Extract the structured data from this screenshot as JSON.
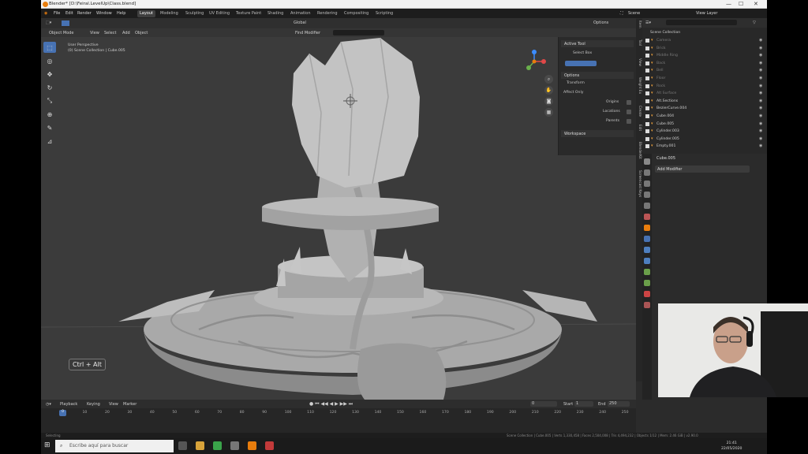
{
  "window": {
    "title": "Blender* [D:\\Feiral.LevelUp\\Class.blend]",
    "controls": [
      "—",
      "☐",
      "✕"
    ]
  },
  "menu": [
    "File",
    "Edit",
    "Render",
    "Window",
    "Help"
  ],
  "workspaces": [
    "Layout",
    "Modeling",
    "Sculpting",
    "UV Editing",
    "Texture Paint",
    "Shading",
    "Animation",
    "Rendering",
    "Compositing",
    "Scripting"
  ],
  "scene": {
    "label": "Scene",
    "view_layer": "View Layer"
  },
  "viewport": {
    "mode": "Object Mode",
    "menu": [
      "View",
      "Select",
      "Add",
      "Object"
    ],
    "orientation": "Global",
    "find_modifier": "Find Modifier",
    "options": "Options",
    "info_line1": "User Perspective",
    "info_line2": "(0) Scene Collection | Cube.005",
    "shortcut_overlay": "Ctrl + Alt"
  },
  "npanel": {
    "active_tool": "Active Tool",
    "tool_name": "Select Box",
    "options": "Options",
    "transform": "Transform",
    "affect_only": "Affect Only",
    "origins": "Origins",
    "locations": "Locations",
    "parents": "Parents",
    "workspace": "Workspace",
    "tabs": [
      "Item",
      "Tool",
      "View",
      "Weight Ex",
      "Create",
      "Edit",
      "BlenderKit",
      "Screencast Keys"
    ]
  },
  "outliner": {
    "title": "Scene Collection",
    "rows": [
      {
        "name": "Camera",
        "dim": true
      },
      {
        "name": "Brick",
        "dim": true
      },
      {
        "name": "Middle Ring",
        "dim": true
      },
      {
        "name": "Back",
        "dim": true
      },
      {
        "name": "Bell",
        "dim": true
      },
      {
        "name": "Floor",
        "dim": true
      },
      {
        "name": "Rock",
        "dim": true
      },
      {
        "name": "Alt Surface",
        "dim": true
      },
      {
        "name": "Alt.Sections",
        "dim": false
      },
      {
        "name": "BezierCurve.004",
        "dim": false
      },
      {
        "name": "Cube.004",
        "dim": false
      },
      {
        "name": "Cube.005",
        "dim": false
      },
      {
        "name": "Cylinder.003",
        "dim": false
      },
      {
        "name": "Cylinder.005",
        "dim": false
      },
      {
        "name": "Empty.001",
        "dim": false
      }
    ]
  },
  "properties": {
    "object": "Cube.005",
    "add_modifier": "Add Modifier"
  },
  "timeline": {
    "menu": [
      "Playback",
      "Keying",
      "View",
      "Marker"
    ],
    "current_frame": "0",
    "start_label": "Start",
    "start": "1",
    "end_label": "End",
    "end": "250",
    "ticks": [
      "0",
      "10",
      "20",
      "30",
      "40",
      "50",
      "60",
      "70",
      "80",
      "90",
      "100",
      "110",
      "120",
      "130",
      "140",
      "150",
      "160",
      "170",
      "180",
      "190",
      "200",
      "210",
      "220",
      "230",
      "240",
      "250"
    ]
  },
  "statusbar": {
    "left": "Selecting",
    "right": "Scene Collection | Cube.005 | Verts 1,330,458 | Faces 2,504,008 | Tris 4,494,232 | Objects 1/12 | Mem: 2.46 GiB | v2.90.0"
  },
  "taskbar": {
    "search_placeholder": "Escribe aquí para buscar",
    "time": "21:41",
    "date": "22/05/2020"
  },
  "colors": {
    "accent": "#4772b3",
    "blender_orange": "#e87d0d",
    "viewport_bg": "#3b3b3b"
  }
}
